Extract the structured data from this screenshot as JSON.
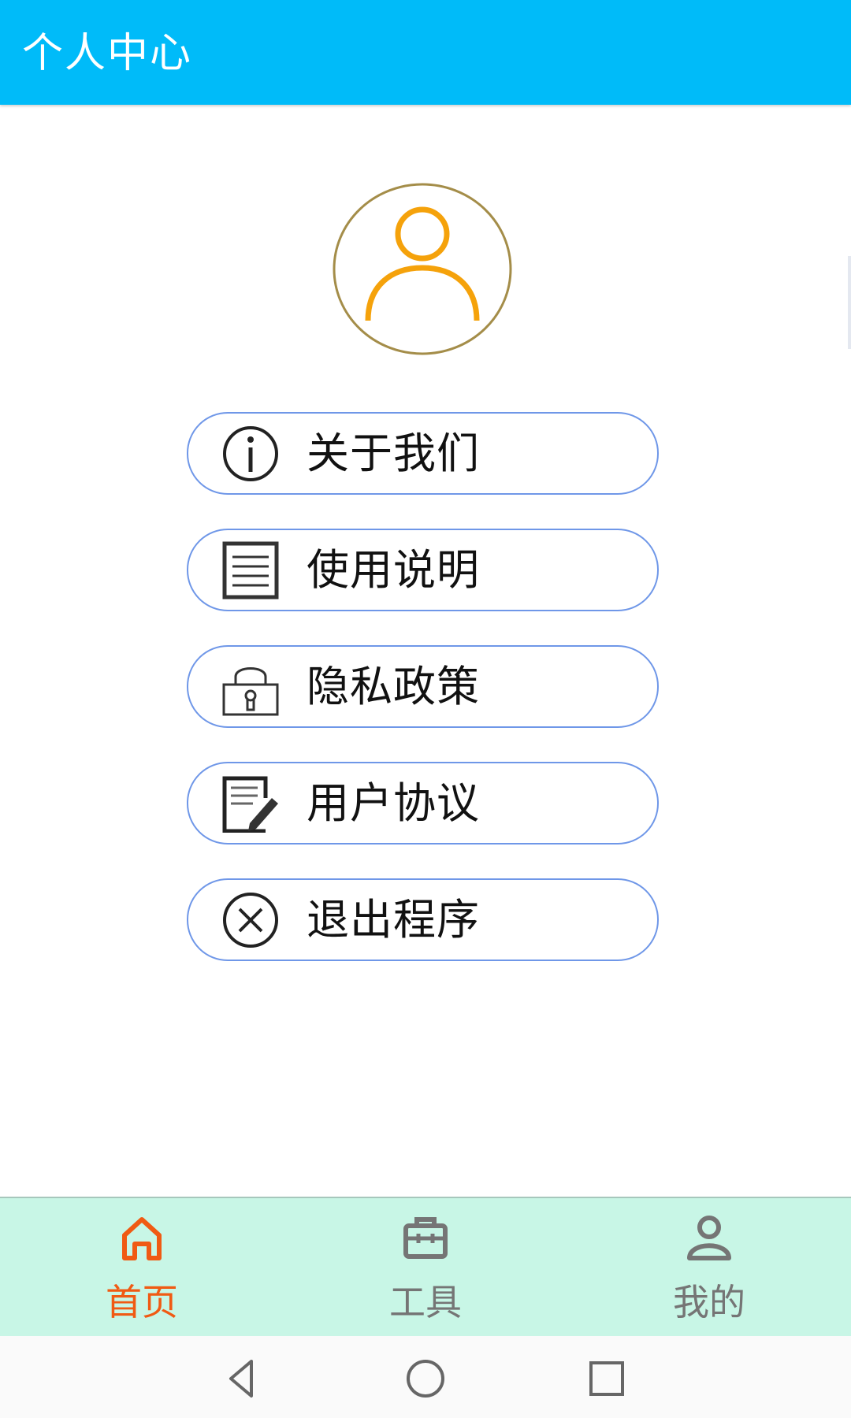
{
  "header": {
    "title": "个人中心"
  },
  "colors": {
    "header_bg": "#00bbf9",
    "menu_border": "#6f97e8",
    "active_tab": "#f05a13",
    "inactive_tab": "#757575",
    "bottom_nav_bg": "#c8f6e6",
    "avatar_accent": "#f5a20b"
  },
  "profile": {
    "avatar_icon": "user-avatar-icon"
  },
  "menu": {
    "items": [
      {
        "label": "关于我们",
        "icon": "info-icon"
      },
      {
        "label": "使用说明",
        "icon": "document-icon"
      },
      {
        "label": "隐私政策",
        "icon": "lock-icon"
      },
      {
        "label": "用户协议",
        "icon": "edit-document-icon"
      },
      {
        "label": "退出程序",
        "icon": "close-circle-icon"
      }
    ]
  },
  "bottom_nav": {
    "items": [
      {
        "label": "首页",
        "icon": "home-icon",
        "active": true
      },
      {
        "label": "工具",
        "icon": "toolbox-icon",
        "active": false
      },
      {
        "label": "我的",
        "icon": "person-icon",
        "active": false
      }
    ]
  },
  "system_nav": {
    "buttons": [
      {
        "icon": "back-icon"
      },
      {
        "icon": "home-circle-icon"
      },
      {
        "icon": "recents-icon"
      }
    ]
  }
}
